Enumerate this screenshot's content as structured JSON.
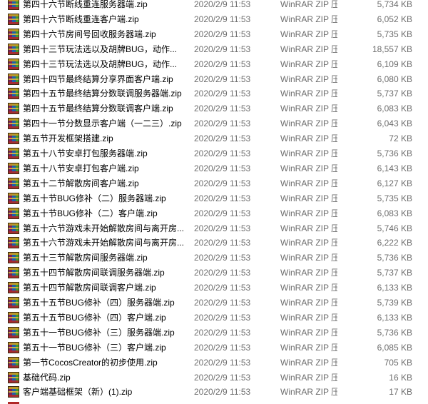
{
  "files": [
    {
      "name": "第四十六节断线重连服务器端.zip",
      "date": "2020/2/9 11:53",
      "type": "WinRAR ZIP 压缩...",
      "size": "5,734 KB"
    },
    {
      "name": "第四十六节断线重连客户端.zip",
      "date": "2020/2/9 11:53",
      "type": "WinRAR ZIP 压缩...",
      "size": "6,052 KB"
    },
    {
      "name": "第四十六节房间号回收服务器端.zip",
      "date": "2020/2/9 11:53",
      "type": "WinRAR ZIP 压缩...",
      "size": "5,735 KB"
    },
    {
      "name": "第四十三节玩法选以及胡牌BUG，动作...",
      "date": "2020/2/9 11:53",
      "type": "WinRAR ZIP 压缩...",
      "size": "18,557 KB"
    },
    {
      "name": "第四十三节玩法选以及胡牌BUG，动作...",
      "date": "2020/2/9 11:53",
      "type": "WinRAR ZIP 压缩...",
      "size": "6,109 KB"
    },
    {
      "name": "第四十四节最终结算分享界面客户端.zip",
      "date": "2020/2/9 11:53",
      "type": "WinRAR ZIP 压缩...",
      "size": "6,080 KB"
    },
    {
      "name": "第四十五节最终结算分数联调服务器端.zip",
      "date": "2020/2/9 11:53",
      "type": "WinRAR ZIP 压缩...",
      "size": "5,737 KB"
    },
    {
      "name": "第四十五节最终结算分数联调客户端.zip",
      "date": "2020/2/9 11:53",
      "type": "WinRAR ZIP 压缩...",
      "size": "6,083 KB"
    },
    {
      "name": "第四十一节分数显示客户端（一二三）.zip",
      "date": "2020/2/9 11:53",
      "type": "WinRAR ZIP 压缩...",
      "size": "6,043 KB"
    },
    {
      "name": "第五节开发框架搭建.zip",
      "date": "2020/2/9 11:53",
      "type": "WinRAR ZIP 压缩...",
      "size": "72 KB"
    },
    {
      "name": "第五十八节安卓打包服务器端.zip",
      "date": "2020/2/9 11:53",
      "type": "WinRAR ZIP 压缩...",
      "size": "5,736 KB"
    },
    {
      "name": "第五十八节安卓打包客户端.zip",
      "date": "2020/2/9 11:53",
      "type": "WinRAR ZIP 压缩...",
      "size": "6,143 KB"
    },
    {
      "name": "第五十二节解散房间客户端.zip",
      "date": "2020/2/9 11:53",
      "type": "WinRAR ZIP 压缩...",
      "size": "6,127 KB"
    },
    {
      "name": "第五十节BUG修补（二）服务器端.zip",
      "date": "2020/2/9 11:53",
      "type": "WinRAR ZIP 压缩...",
      "size": "5,735 KB"
    },
    {
      "name": "第五十节BUG修补（二）客户端.zip",
      "date": "2020/2/9 11:53",
      "type": "WinRAR ZIP 压缩...",
      "size": "6,083 KB"
    },
    {
      "name": "第五十六节游戏未开始解散房间与离开房...",
      "date": "2020/2/9 11:53",
      "type": "WinRAR ZIP 压缩...",
      "size": "5,746 KB"
    },
    {
      "name": "第五十六节游戏未开始解散房间与离开房...",
      "date": "2020/2/9 11:53",
      "type": "WinRAR ZIP 压缩...",
      "size": "6,222 KB"
    },
    {
      "name": "第五十三节解散房间服务器端.zip",
      "date": "2020/2/9 11:53",
      "type": "WinRAR ZIP 压缩...",
      "size": "5,736 KB"
    },
    {
      "name": "第五十四节解散房间联调服务器端.zip",
      "date": "2020/2/9 11:53",
      "type": "WinRAR ZIP 压缩...",
      "size": "5,737 KB"
    },
    {
      "name": "第五十四节解散房间联调客户端.zip",
      "date": "2020/2/9 11:53",
      "type": "WinRAR ZIP 压缩...",
      "size": "6,133 KB"
    },
    {
      "name": "第五十五节BUG修补（四）服务器端.zip",
      "date": "2020/2/9 11:53",
      "type": "WinRAR ZIP 压缩...",
      "size": "5,739 KB"
    },
    {
      "name": "第五十五节BUG修补（四）客户端.zip",
      "date": "2020/2/9 11:53",
      "type": "WinRAR ZIP 压缩...",
      "size": "6,133 KB"
    },
    {
      "name": "第五十一节BUG修补（三）服务器端.zip",
      "date": "2020/2/9 11:53",
      "type": "WinRAR ZIP 压缩...",
      "size": "5,736 KB"
    },
    {
      "name": "第五十一节BUG修补（三）客户端.zip",
      "date": "2020/2/9 11:53",
      "type": "WinRAR ZIP 压缩...",
      "size": "6,085 KB"
    },
    {
      "name": "第一节CocosCreator的初步使用.zip",
      "date": "2020/2/9 11:53",
      "type": "WinRAR ZIP 压缩...",
      "size": "705 KB"
    },
    {
      "name": "基础代码.zip",
      "date": "2020/2/9 11:53",
      "type": "WinRAR ZIP 压缩...",
      "size": "16 KB"
    },
    {
      "name": "客户端基础框架（新）(1).zip",
      "date": "2020/2/9 11:53",
      "type": "WinRAR ZIP 压缩...",
      "size": "17 KB"
    }
  ],
  "icon": "winrar-zip-icon"
}
